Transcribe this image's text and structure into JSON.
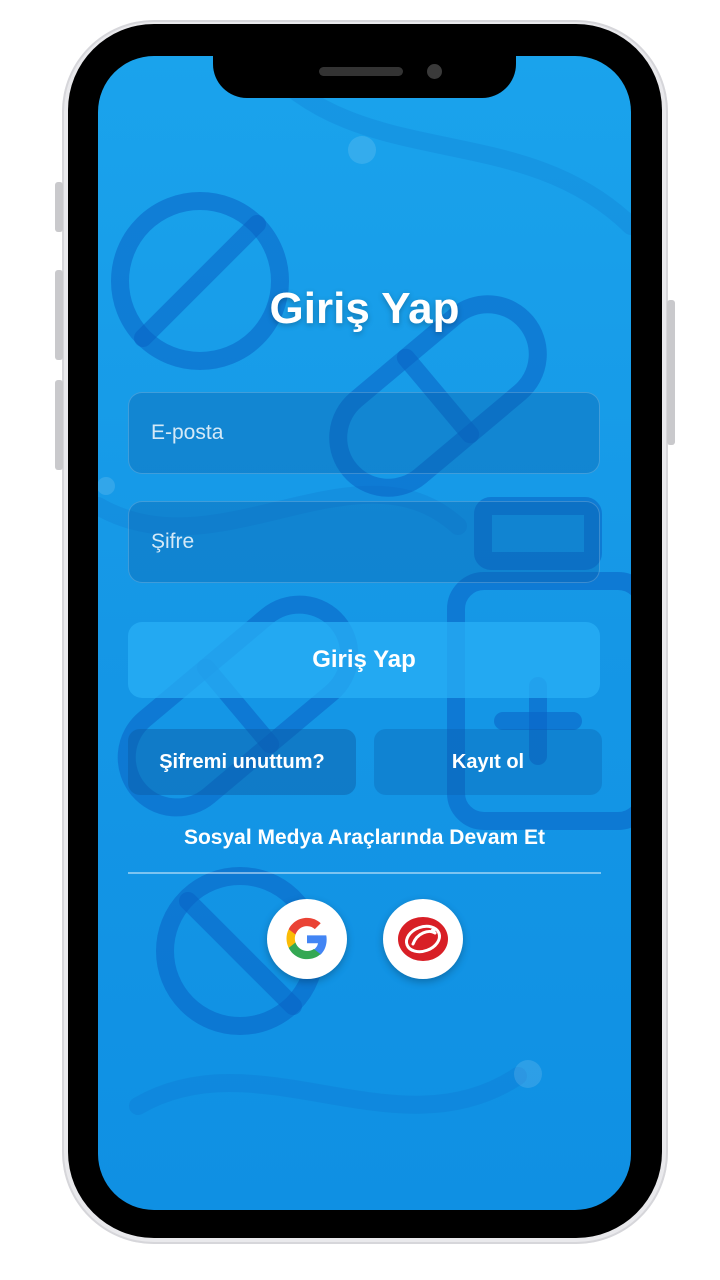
{
  "login": {
    "title": "Giriş Yap",
    "email_placeholder": "E-posta",
    "password_placeholder": "Şifre",
    "submit_label": "Giriş Yap",
    "forgot_label": "Şifremi unuttum?",
    "register_label": "Kayıt ol",
    "social_heading": "Sosyal Medya Araçlarında Devam Et"
  },
  "social": [
    {
      "icon": "google-icon"
    },
    {
      "icon": "e-devlet-icon"
    }
  ],
  "colors": {
    "screen_bg": "#1597e6",
    "accent": "#0a63c4",
    "text": "#ffffff",
    "brand_red": "#d81f26"
  }
}
